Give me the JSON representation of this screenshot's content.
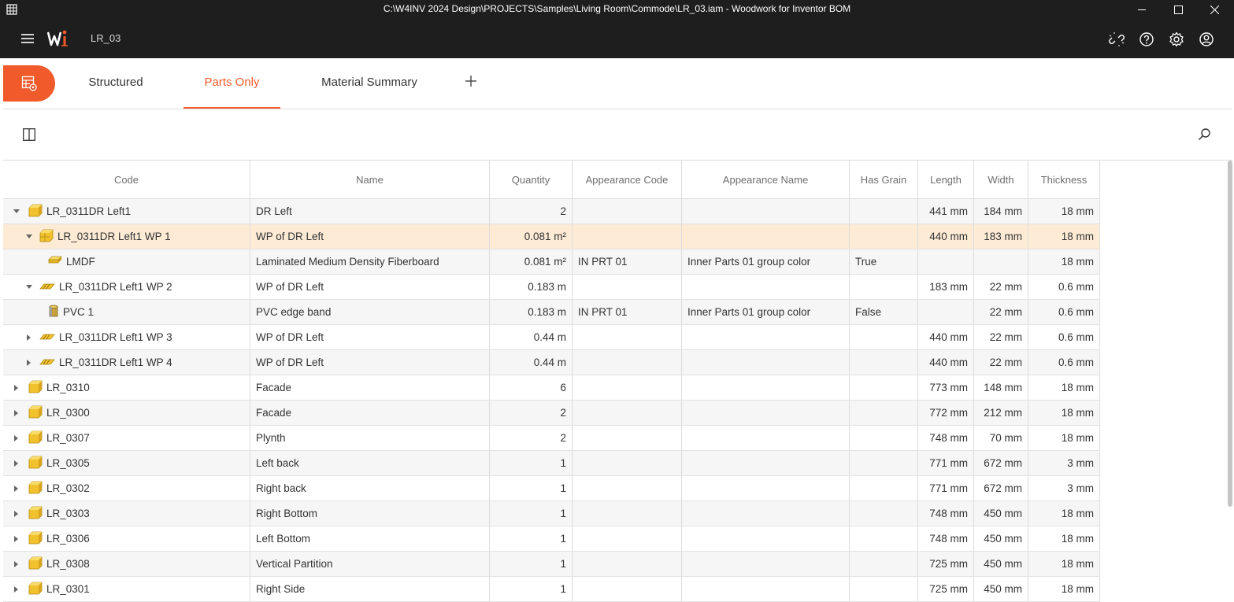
{
  "window": {
    "title": "C:\\W4INV 2024 Design\\PROJECTS\\Samples\\Living Room\\Commode\\LR_03.iam - Woodwork for Inventor BOM"
  },
  "header": {
    "document": "LR_03"
  },
  "tabs": {
    "structured": "Structured",
    "parts_only": "Parts Only",
    "material_summary": "Material Summary"
  },
  "columns": [
    "Code",
    "Name",
    "Quantity",
    "Appearance Code",
    "Appearance Name",
    "Has Grain",
    "Length",
    "Width",
    "Thickness"
  ],
  "rows": [
    {
      "code": "LR_0311DR Left1",
      "name": "DR Left",
      "qty": "2",
      "ac": "",
      "an": "",
      "hg": "",
      "len": "441 mm",
      "wid": "184 mm",
      "th": "18 mm",
      "level": 0,
      "caret": "down",
      "icon": "part-icon",
      "style": "alt"
    },
    {
      "code": "LR_0311DR Left1 WP 1",
      "name": "WP of DR Left",
      "qty": "0.081 m²",
      "ac": "",
      "an": "",
      "hg": "",
      "len": "440 mm",
      "wid": "183 mm",
      "th": "18 mm",
      "level": 1,
      "caret": "down",
      "icon": "workpiece-icon",
      "style": "sel"
    },
    {
      "code": "LMDF",
      "name": "Laminated Medium Density Fiberboard",
      "qty": "0.081 m²",
      "ac": "IN PRT 01",
      "an": "Inner Parts 01 group color",
      "hg": "True",
      "len": "",
      "wid": "",
      "th": "18 mm",
      "level": 2,
      "caret": "none",
      "icon": "sheet-material-icon",
      "style": "alt"
    },
    {
      "code": "LR_0311DR Left1 WP 2",
      "name": "WP of DR Left",
      "qty": "0.183 m",
      "ac": "",
      "an": "",
      "hg": "",
      "len": "183 mm",
      "wid": "22 mm",
      "th": "0.6 mm",
      "level": 1,
      "caret": "down",
      "icon": "edgeband-icon",
      "style": ""
    },
    {
      "code": "PVC 1",
      "name": "PVC edge band",
      "qty": "0.183 m",
      "ac": "IN PRT 01",
      "an": "Inner Parts 01 group color",
      "hg": "False",
      "len": "",
      "wid": "22 mm",
      "th": "0.6 mm",
      "level": 2,
      "caret": "none",
      "icon": "edgeband-roll-icon",
      "style": "alt"
    },
    {
      "code": "LR_0311DR Left1 WP 3",
      "name": "WP of DR Left",
      "qty": "0.44 m",
      "ac": "",
      "an": "",
      "hg": "",
      "len": "440 mm",
      "wid": "22 mm",
      "th": "0.6 mm",
      "level": 1,
      "caret": "right",
      "icon": "edgeband-icon",
      "style": ""
    },
    {
      "code": "LR_0311DR Left1 WP 4",
      "name": "WP of DR Left",
      "qty": "0.44 m",
      "ac": "",
      "an": "",
      "hg": "",
      "len": "440 mm",
      "wid": "22 mm",
      "th": "0.6 mm",
      "level": 1,
      "caret": "right",
      "icon": "edgeband-icon",
      "style": "alt"
    },
    {
      "code": "LR_0310",
      "name": "Facade",
      "qty": "6",
      "ac": "",
      "an": "",
      "hg": "",
      "len": "773 mm",
      "wid": "148 mm",
      "th": "18 mm",
      "level": 0,
      "caret": "right",
      "icon": "part-icon",
      "style": ""
    },
    {
      "code": "LR_0300",
      "name": "Facade",
      "qty": "2",
      "ac": "",
      "an": "",
      "hg": "",
      "len": "772 mm",
      "wid": "212 mm",
      "th": "18 mm",
      "level": 0,
      "caret": "right",
      "icon": "part-icon",
      "style": "alt"
    },
    {
      "code": "LR_0307",
      "name": "Plynth",
      "qty": "2",
      "ac": "",
      "an": "",
      "hg": "",
      "len": "748 mm",
      "wid": "70 mm",
      "th": "18 mm",
      "level": 0,
      "caret": "right",
      "icon": "part-icon",
      "style": ""
    },
    {
      "code": "LR_0305",
      "name": "Left back",
      "qty": "1",
      "ac": "",
      "an": "",
      "hg": "",
      "len": "771 mm",
      "wid": "672 mm",
      "th": "3 mm",
      "level": 0,
      "caret": "right",
      "icon": "part-icon",
      "style": "alt"
    },
    {
      "code": "LR_0302",
      "name": "Right back",
      "qty": "1",
      "ac": "",
      "an": "",
      "hg": "",
      "len": "771 mm",
      "wid": "672 mm",
      "th": "3 mm",
      "level": 0,
      "caret": "right",
      "icon": "part-icon",
      "style": ""
    },
    {
      "code": "LR_0303",
      "name": "Right Bottom",
      "qty": "1",
      "ac": "",
      "an": "",
      "hg": "",
      "len": "748 mm",
      "wid": "450 mm",
      "th": "18 mm",
      "level": 0,
      "caret": "right",
      "icon": "part-icon",
      "style": "alt"
    },
    {
      "code": "LR_0306",
      "name": "Left Bottom",
      "qty": "1",
      "ac": "",
      "an": "",
      "hg": "",
      "len": "748 mm",
      "wid": "450 mm",
      "th": "18 mm",
      "level": 0,
      "caret": "right",
      "icon": "part-icon",
      "style": ""
    },
    {
      "code": "LR_0308",
      "name": "Vertical Partition",
      "qty": "1",
      "ac": "",
      "an": "",
      "hg": "",
      "len": "725 mm",
      "wid": "450 mm",
      "th": "18 mm",
      "level": 0,
      "caret": "right",
      "icon": "part-icon",
      "style": "alt"
    },
    {
      "code": "LR_0301",
      "name": "Right Side",
      "qty": "1",
      "ac": "",
      "an": "",
      "hg": "",
      "len": "725 mm",
      "wid": "450 mm",
      "th": "18 mm",
      "level": 0,
      "caret": "right",
      "icon": "part-icon",
      "style": ""
    }
  ],
  "colors": {
    "accent": "#f15a2b",
    "titlebar": "#1e1e1e",
    "selected_row": "#fdebd6",
    "part_yellow": "#f2c12e"
  }
}
